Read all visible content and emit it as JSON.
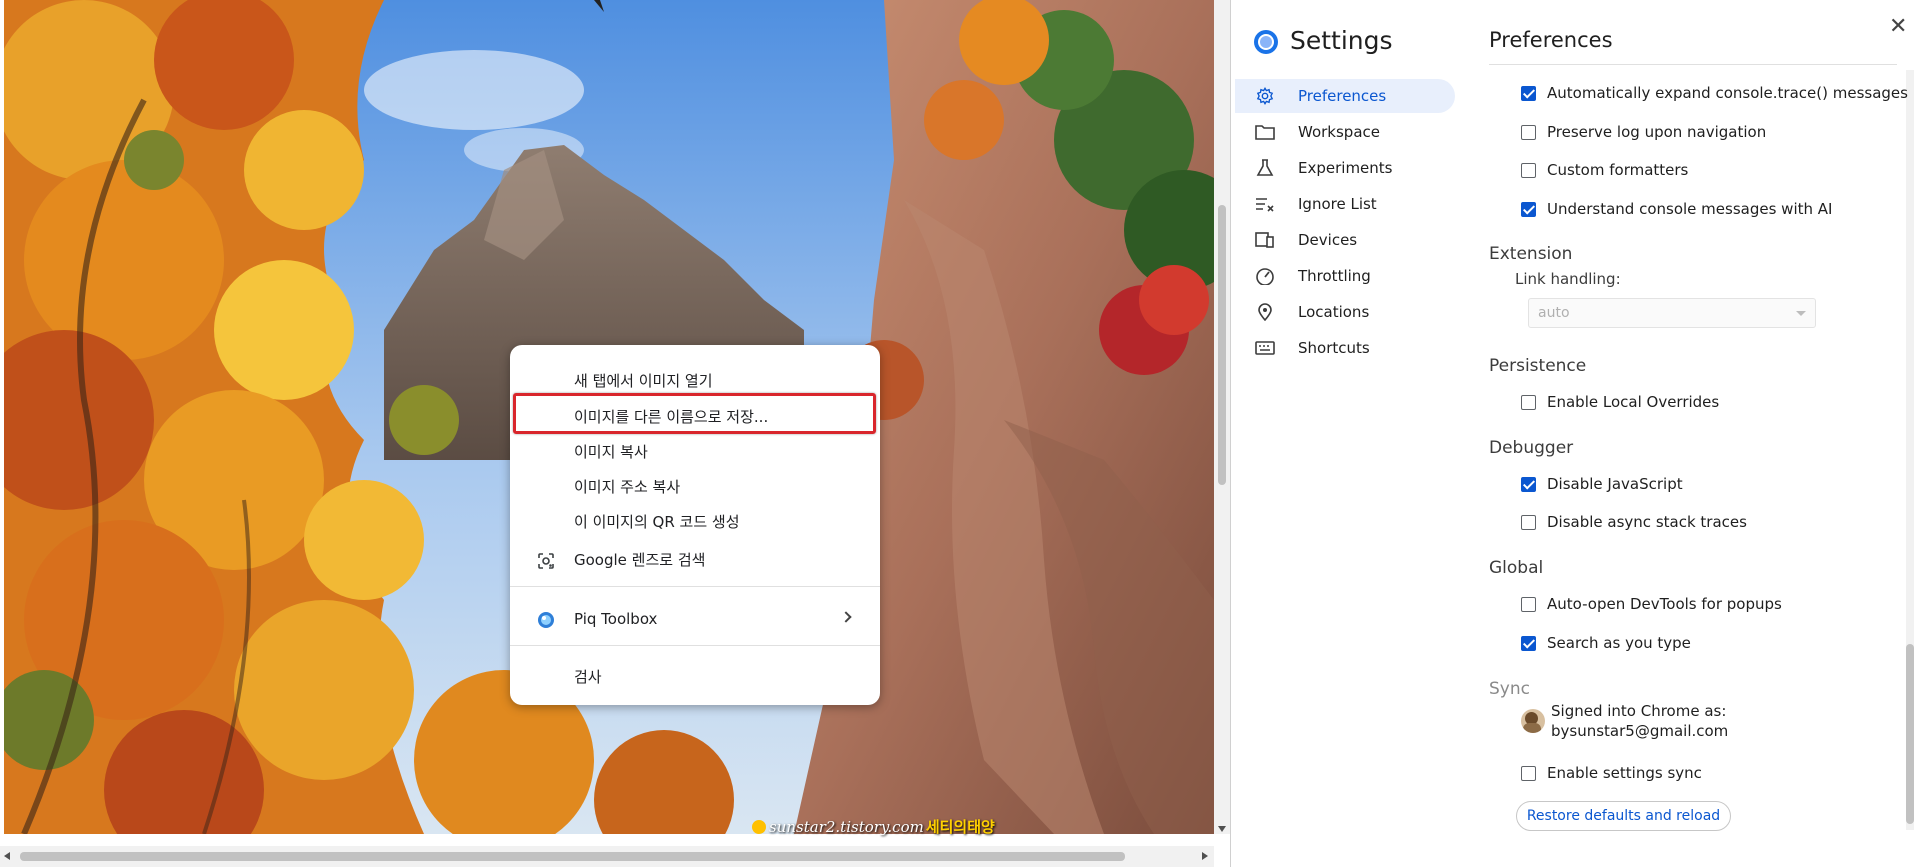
{
  "context_menu": {
    "items": [
      {
        "label": "새 탭에서 이미지 열기"
      },
      {
        "label": "이미지를 다른 이름으로 저장..."
      },
      {
        "label": "이미지 복사"
      },
      {
        "label": "이미지 주소 복사"
      },
      {
        "label": "이 이미지의 QR 코드 생성"
      },
      {
        "label": "Google 렌즈로 검색",
        "icon": "google-lens-icon"
      },
      {
        "label": "Piq Toolbox",
        "icon": "piq-toolbox-icon"
      },
      {
        "label": "검사"
      }
    ]
  },
  "watermark": {
    "url": "sunstar2.tistory.com",
    "name": "세티의태양"
  },
  "settings": {
    "title": "Settings",
    "nav": [
      {
        "label": "Preferences",
        "icon": "gear-icon",
        "selected": true
      },
      {
        "label": "Workspace",
        "icon": "folder-icon"
      },
      {
        "label": "Experiments",
        "icon": "flask-icon"
      },
      {
        "label": "Ignore List",
        "icon": "ignore-list-icon"
      },
      {
        "label": "Devices",
        "icon": "devices-icon"
      },
      {
        "label": "Throttling",
        "icon": "speedometer-icon"
      },
      {
        "label": "Locations",
        "icon": "location-pin-icon"
      },
      {
        "label": "Shortcuts",
        "icon": "keyboard-icon"
      }
    ],
    "preferences": {
      "header": "Preferences",
      "console_options": [
        {
          "label": "Automatically expand console.trace() messages",
          "checked": true
        },
        {
          "label": "Preserve log upon navigation",
          "checked": false
        },
        {
          "label": "Custom formatters",
          "checked": false
        },
        {
          "label": "Understand console messages with AI",
          "checked": true
        }
      ],
      "extension": {
        "title": "Extension",
        "link_handling_label": "Link handling:",
        "link_handling_value": "auto"
      },
      "persistence": {
        "title": "Persistence",
        "options": [
          {
            "label": "Enable Local Overrides",
            "checked": false
          }
        ]
      },
      "debugger": {
        "title": "Debugger",
        "options": [
          {
            "label": "Disable JavaScript",
            "checked": true
          },
          {
            "label": "Disable async stack traces",
            "checked": false
          }
        ]
      },
      "global": {
        "title": "Global",
        "options": [
          {
            "label": "Auto-open DevTools for popups",
            "checked": false
          },
          {
            "label": "Search as you type",
            "checked": true
          }
        ]
      },
      "sync": {
        "title": "Sync",
        "signed_in_label": "Signed into Chrome as:",
        "email": "bysunstar5@gmail.com",
        "options": [
          {
            "label": "Enable settings sync",
            "checked": false
          }
        ]
      },
      "restore_button": "Restore defaults and reload"
    }
  },
  "colors": {
    "accent": "#0b57d0",
    "highlight_box": "#d9262c",
    "nav_selected_bg": "#e8effc"
  }
}
